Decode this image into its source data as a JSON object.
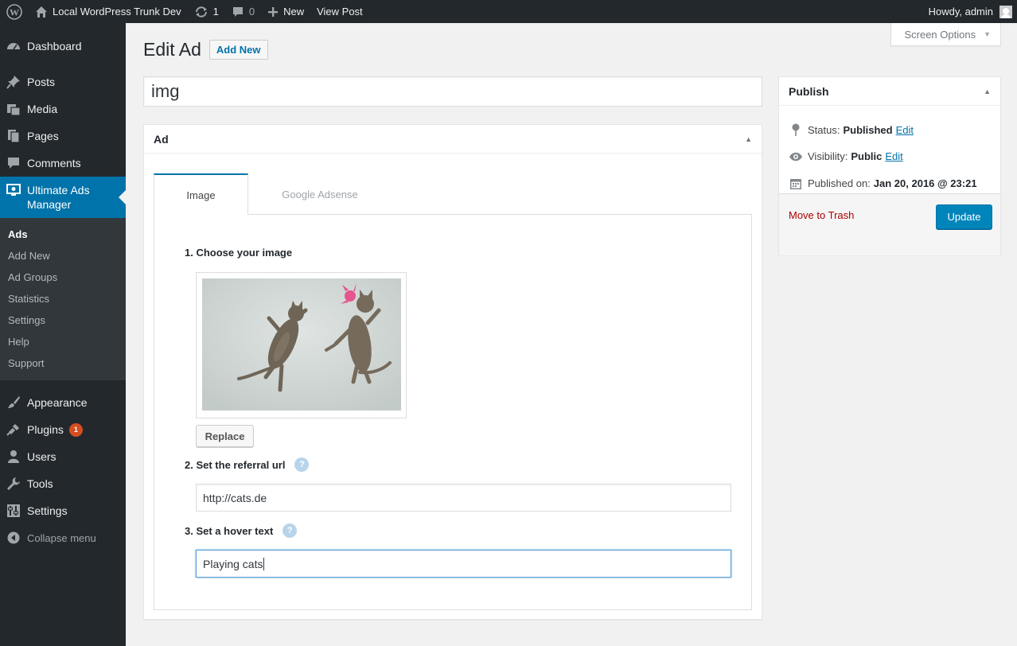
{
  "adminbar": {
    "site_name": "Local WordPress Trunk Dev",
    "updates_count": "1",
    "comments_count": "0",
    "new_label": "New",
    "view_post_label": "View Post",
    "howdy": "Howdy, admin"
  },
  "sidebar": {
    "dashboard": "Dashboard",
    "posts": "Posts",
    "media": "Media",
    "pages": "Pages",
    "comments": "Comments",
    "ultimate_ads": "Ultimate Ads Manager",
    "submenu": {
      "ads": "Ads",
      "add_new": "Add New",
      "ad_groups": "Ad Groups",
      "statistics": "Statistics",
      "settings": "Settings",
      "help": "Help",
      "support": "Support"
    },
    "appearance": "Appearance",
    "plugins": "Plugins",
    "plugins_badge": "1",
    "users": "Users",
    "tools": "Tools",
    "settings": "Settings",
    "collapse": "Collapse menu"
  },
  "header": {
    "screen_options": "Screen Options",
    "title": "Edit Ad",
    "add_new": "Add New"
  },
  "post": {
    "title_value": "img"
  },
  "ad_box": {
    "heading": "Ad",
    "tabs": [
      "Image",
      "Google Adsense"
    ],
    "step1_label": "1. Choose your image",
    "replace_button": "Replace",
    "step2_label": "2. Set the referral url",
    "referral_url": "http://cats.de",
    "step3_label": "3. Set a hover text",
    "hover_text": "Playing cats",
    "help_glyph": "?"
  },
  "publish_box": {
    "heading": "Publish",
    "status_label": "Status:",
    "status_value": "Published",
    "visibility_label": "Visibility:",
    "visibility_value": "Public",
    "published_label": "Published on:",
    "published_value": "Jan 20, 2016 @ 23:21",
    "edit_link": "Edit",
    "trash_link": "Move to Trash",
    "update_button": "Update"
  },
  "colors": {
    "adminbar_bg": "#23282d",
    "accent_blue": "#0073aa",
    "primary_button": "#0085ba",
    "badge_orange": "#d54e21",
    "trash_red": "#a00"
  }
}
